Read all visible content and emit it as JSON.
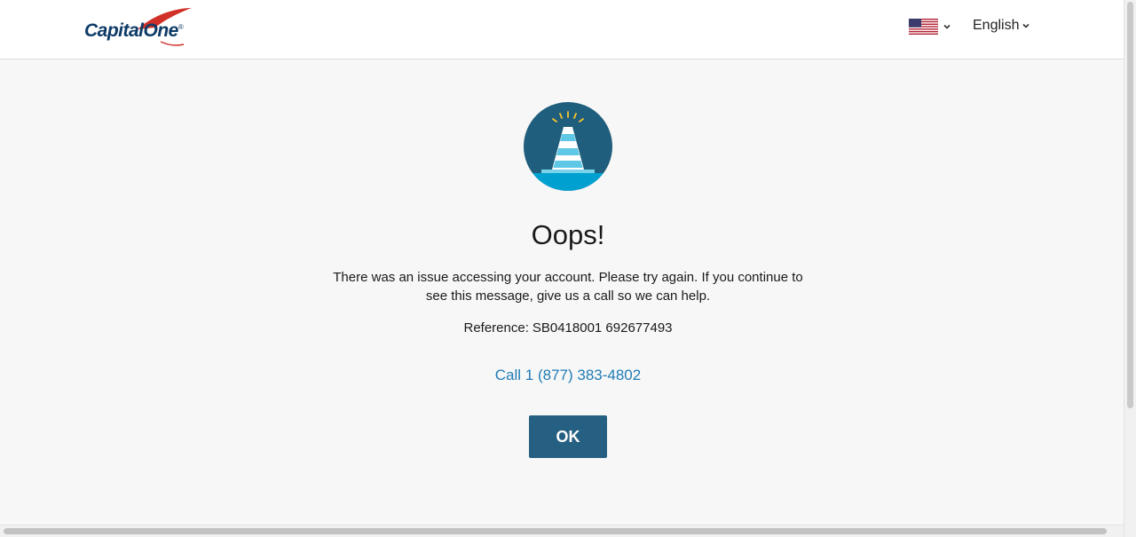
{
  "header": {
    "logo_text": "Capital",
    "logo_text_2": "One",
    "logo_reg": "®",
    "language_label": "English",
    "flag_icon": "us-flag-icon"
  },
  "error": {
    "title": "Oops!",
    "message": "There was an issue accessing your account. Please try again. If you continue to see this message, give us a call so we can help.",
    "reference_label": "Reference:",
    "reference_value": "SB0418001 692677493",
    "call_link": "Call 1 (877) 383-4802",
    "ok_button": "OK",
    "illustration": "traffic-cone-icon"
  },
  "colors": {
    "brand_navy": "#0d3b66",
    "brand_red": "#d03027",
    "button": "#255f82",
    "link": "#1f7bb5",
    "cone_bg": "#1f5e7d",
    "cone_base": "#00a0d0"
  }
}
